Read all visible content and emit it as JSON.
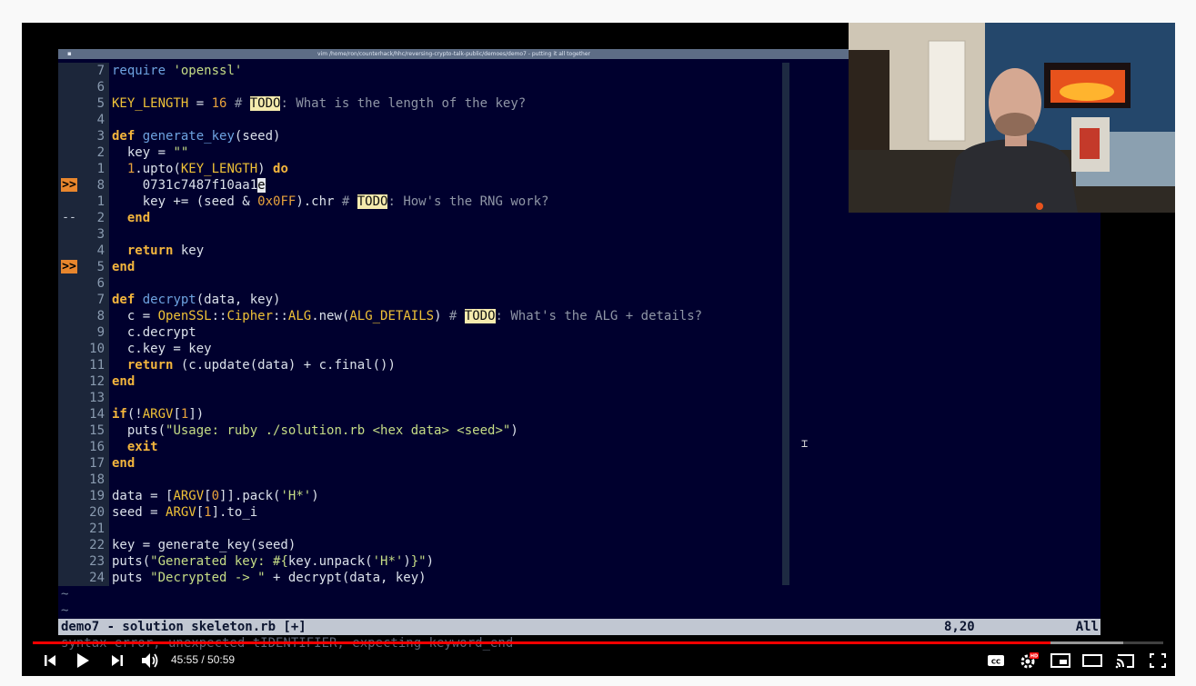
{
  "window_title": "vim /home/ron/counterhack/hhc/reversing-crypto-talk-public/demoes/demo7 - putting it all together",
  "lines": [
    {
      "num": "7",
      "tokens": [
        [
          "fn",
          "require"
        ],
        [
          "plain",
          " "
        ],
        [
          "str",
          "'openssl'"
        ]
      ]
    },
    {
      "num": "6",
      "tokens": []
    },
    {
      "num": "5",
      "tokens": [
        [
          "const",
          "KEY_LENGTH"
        ],
        [
          "plain",
          " = "
        ],
        [
          "num",
          "16"
        ],
        [
          "plain",
          " "
        ],
        [
          "cm",
          "# "
        ],
        [
          "todo",
          "TODO"
        ],
        [
          "cm",
          ": What is the length of the key?"
        ]
      ]
    },
    {
      "num": "4",
      "tokens": []
    },
    {
      "num": "3",
      "tokens": [
        [
          "kw",
          "def"
        ],
        [
          "plain",
          " "
        ],
        [
          "fn",
          "generate_key"
        ],
        [
          "plain",
          "(seed)"
        ]
      ]
    },
    {
      "num": "2",
      "tokens": [
        [
          "plain",
          "  key = "
        ],
        [
          "str",
          "\"\""
        ]
      ]
    },
    {
      "num": "1",
      "tokens": [
        [
          "plain",
          "  "
        ],
        [
          "num",
          "1"
        ],
        [
          "plain",
          ".upto("
        ],
        [
          "const",
          "KEY_LENGTH"
        ],
        [
          "plain",
          ") "
        ],
        [
          "kw",
          "do"
        ]
      ]
    },
    {
      "num": "8",
      "sign": ">>",
      "tokens": [
        [
          "plain",
          "    0731c7487f10aa1"
        ],
        [
          "cursor",
          "e"
        ]
      ]
    },
    {
      "num": "1",
      "tokens": [
        [
          "plain",
          "    key += (seed & "
        ],
        [
          "num",
          "0x0FF"
        ],
        [
          "plain",
          ").chr "
        ],
        [
          "cm",
          "# "
        ],
        [
          "todo",
          "TODO"
        ],
        [
          "cm",
          ": How's the RNG work?"
        ]
      ]
    },
    {
      "num": "2",
      "sign": "--",
      "tokens": [
        [
          "plain",
          "  "
        ],
        [
          "kw",
          "end"
        ]
      ]
    },
    {
      "num": "3",
      "tokens": []
    },
    {
      "num": "4",
      "tokens": [
        [
          "plain",
          "  "
        ],
        [
          "kw",
          "return"
        ],
        [
          "plain",
          " key"
        ]
      ]
    },
    {
      "num": "5",
      "sign": ">>",
      "tokens": [
        [
          "kw",
          "end"
        ]
      ]
    },
    {
      "num": "6",
      "tokens": []
    },
    {
      "num": "7",
      "tokens": [
        [
          "kw",
          "def"
        ],
        [
          "plain",
          " "
        ],
        [
          "fn",
          "decrypt"
        ],
        [
          "plain",
          "(data, key)"
        ]
      ]
    },
    {
      "num": "8",
      "tokens": [
        [
          "plain",
          "  c = "
        ],
        [
          "const",
          "OpenSSL"
        ],
        [
          "plain",
          "::"
        ],
        [
          "const",
          "Cipher"
        ],
        [
          "plain",
          "::"
        ],
        [
          "const",
          "ALG"
        ],
        [
          "plain",
          ".new("
        ],
        [
          "const",
          "ALG_DETAILS"
        ],
        [
          "plain",
          ") "
        ],
        [
          "cm",
          "# "
        ],
        [
          "todo",
          "TODO"
        ],
        [
          "cm",
          ": What's the ALG + details?"
        ]
      ]
    },
    {
      "num": "9",
      "tokens": [
        [
          "plain",
          "  c.decrypt"
        ]
      ]
    },
    {
      "num": "10",
      "tokens": [
        [
          "plain",
          "  c.key = key"
        ]
      ]
    },
    {
      "num": "11",
      "tokens": [
        [
          "plain",
          "  "
        ],
        [
          "kw",
          "return"
        ],
        [
          "plain",
          " (c.update(data) + c.final())"
        ]
      ]
    },
    {
      "num": "12",
      "tokens": [
        [
          "kw",
          "end"
        ]
      ]
    },
    {
      "num": "13",
      "tokens": []
    },
    {
      "num": "14",
      "tokens": [
        [
          "kw",
          "if"
        ],
        [
          "plain",
          "(!"
        ],
        [
          "const",
          "ARGV"
        ],
        [
          "plain",
          "["
        ],
        [
          "num",
          "1"
        ],
        [
          "plain",
          "])"
        ]
      ]
    },
    {
      "num": "15",
      "tokens": [
        [
          "plain",
          "  puts("
        ],
        [
          "str",
          "\"Usage: ruby ./solution.rb <hex data> <seed>\""
        ],
        [
          "plain",
          ")"
        ]
      ]
    },
    {
      "num": "16",
      "tokens": [
        [
          "plain",
          "  "
        ],
        [
          "kw",
          "exit"
        ]
      ]
    },
    {
      "num": "17",
      "tokens": [
        [
          "kw",
          "end"
        ]
      ]
    },
    {
      "num": "18",
      "tokens": []
    },
    {
      "num": "19",
      "tokens": [
        [
          "plain",
          "data = ["
        ],
        [
          "const",
          "ARGV"
        ],
        [
          "plain",
          "["
        ],
        [
          "num",
          "0"
        ],
        [
          "plain",
          "]].pack("
        ],
        [
          "str",
          "'H*'"
        ],
        [
          "plain",
          ")"
        ]
      ]
    },
    {
      "num": "20",
      "tokens": [
        [
          "plain",
          "seed = "
        ],
        [
          "const",
          "ARGV"
        ],
        [
          "plain",
          "["
        ],
        [
          "num",
          "1"
        ],
        [
          "plain",
          "].to_i"
        ]
      ]
    },
    {
      "num": "21",
      "tokens": []
    },
    {
      "num": "22",
      "tokens": [
        [
          "plain",
          "key = generate_key(seed)"
        ]
      ]
    },
    {
      "num": "23",
      "tokens": [
        [
          "plain",
          "puts("
        ],
        [
          "str",
          "\"Generated key: #{"
        ],
        [
          "plain",
          "key.unpack("
        ],
        [
          "str",
          "'H*'"
        ],
        [
          "plain",
          ")"
        ],
        [
          "str",
          "}\""
        ],
        [
          "plain",
          ")"
        ]
      ]
    },
    {
      "num": "24",
      "tokens": [
        [
          "plain",
          "puts "
        ],
        [
          "str",
          "\"Decrypted -> \""
        ],
        [
          "plain",
          " + decrypt(data, key)"
        ]
      ]
    }
  ],
  "tildes": [
    "~",
    "~"
  ],
  "status": {
    "filename": "demo7 - solution skeleton.rb [+]",
    "position": "8,20",
    "scroll": "All"
  },
  "message": "syntax error, unexpected tIDENTIFIER, expecting keyword_end",
  "player": {
    "time": "45:55 / 50:59",
    "progress": 0.9,
    "buffered": 0.965,
    "quality_badge": "HD",
    "icons": {
      "prev": "skip-previous-icon",
      "play": "play-icon",
      "next": "skip-next-icon",
      "volume": "volume-icon",
      "cc": "captions-icon",
      "settings": "settings-gear-icon",
      "miniplayer": "miniplayer-icon",
      "theater": "theater-mode-icon",
      "cast": "cast-icon",
      "fullscreen": "fullscreen-icon"
    }
  },
  "colors": {
    "editor_bg": "#00002e",
    "progress": "#ff0000",
    "sign_column": "#e8862d"
  }
}
